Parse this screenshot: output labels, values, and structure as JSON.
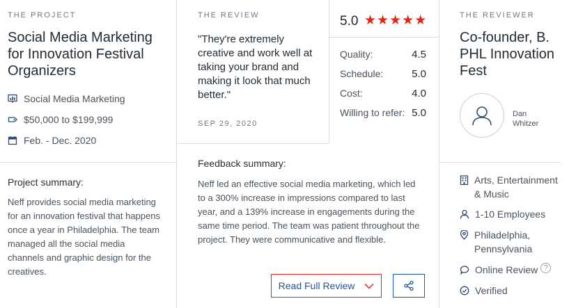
{
  "project": {
    "eyebrow": "THE PROJECT",
    "title": "Social Media Marketing for Innovation Festival Organizers",
    "service": "Social Media Marketing",
    "budget": "$50,000 to $199,999",
    "dates": "Feb. - Dec. 2020",
    "summary_label": "Project summary:",
    "summary_text": "Neff provides social media marketing for an innovation festival that happens once a year in Philadelphia. The team managed all the social media channels and graphic design for the creatives."
  },
  "review": {
    "eyebrow": "THE REVIEW",
    "quote": "\"They're extremely creative and work well at taking your brand and making it look that much better.\"",
    "date": "SEP 29, 2020",
    "overall": "5.0",
    "stars": 5,
    "ratings": [
      {
        "label": "Quality:",
        "value": "4.5"
      },
      {
        "label": "Schedule:",
        "value": "5.0"
      },
      {
        "label": "Cost:",
        "value": "4.0"
      },
      {
        "label": "Willing to refer:",
        "value": "5.0"
      }
    ],
    "feedback_label": "Feedback summary:",
    "feedback_text": "Neff led an effective social media marketing, which led to a 300% increase in impressions compared to last year, and a 139% increase in engagements during the same time period. The team was patient throughout the project. They were communicative and flexible.",
    "read_full_label": "Read Full Review"
  },
  "reviewer": {
    "eyebrow": "THE REVIEWER",
    "title": "Co-founder, B. PHL Innovation Fest",
    "first_name": "Dan",
    "last_name": "Whitzer",
    "industry": "Arts, Entertainment & Music",
    "employees": "1-10 Employees",
    "location": "Philadelphia, Pennsylvania",
    "review_type": "Online Review",
    "help_mark": "?",
    "verification": "Verified"
  },
  "colors": {
    "accent_red": "#e62415",
    "link_blue": "#1c56a8",
    "divider": "#d7dde3"
  },
  "icons": [
    "chart-icon",
    "tag-icon",
    "calendar-icon",
    "user-icon",
    "building-icon",
    "person-icon",
    "location-icon",
    "chat-icon",
    "check-circle-icon",
    "chevron-down-icon",
    "share-icon"
  ]
}
